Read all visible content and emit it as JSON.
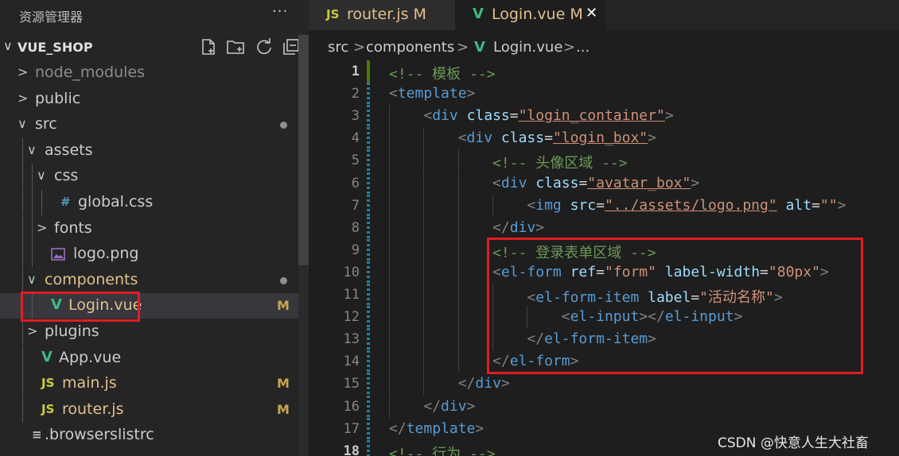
{
  "sidebar": {
    "title": "资源管理器",
    "more_label": "···",
    "project": "VUE_SHOP",
    "actions": [
      "new-file-icon",
      "new-folder-icon",
      "refresh-icon",
      "collapse-all-icon"
    ],
    "tree": [
      {
        "label": "node_modules",
        "type": "folder",
        "expanded": false,
        "depth": 0,
        "dim": true
      },
      {
        "label": "public",
        "type": "folder",
        "expanded": false,
        "depth": 0
      },
      {
        "label": "src",
        "type": "folder",
        "expanded": true,
        "depth": 0,
        "modified_dot": true
      },
      {
        "label": "assets",
        "type": "folder",
        "expanded": true,
        "depth": 1
      },
      {
        "label": "css",
        "type": "folder",
        "expanded": true,
        "depth": 2
      },
      {
        "label": "global.css",
        "type": "css",
        "icon": "#",
        "depth": 3
      },
      {
        "label": "fonts",
        "type": "folder",
        "expanded": false,
        "depth": 2
      },
      {
        "label": "logo.png",
        "type": "image",
        "depth": 2
      },
      {
        "label": "components",
        "type": "folder",
        "expanded": true,
        "depth": 1,
        "modified_dot": true,
        "modified": true
      },
      {
        "label": "Login.vue",
        "type": "vue",
        "icon": "V",
        "depth": 2,
        "badge": "M",
        "modified": true,
        "selected": true
      },
      {
        "label": "plugins",
        "type": "folder",
        "expanded": false,
        "depth": 1
      },
      {
        "label": "App.vue",
        "type": "vue",
        "icon": "V",
        "depth": 1
      },
      {
        "label": "main.js",
        "type": "js",
        "icon": "JS",
        "depth": 1,
        "badge": "M",
        "modified": true
      },
      {
        "label": "router.js",
        "type": "js",
        "icon": "JS",
        "depth": 1,
        "badge": "M",
        "modified": true
      },
      {
        "label": ".browserslistrc",
        "type": "config",
        "icon": "≡",
        "depth": 0
      }
    ]
  },
  "tabs": [
    {
      "icon": "JS",
      "label": "router.js",
      "badge": "M",
      "active": false
    },
    {
      "icon": "V",
      "label": "Login.vue",
      "badge": "M",
      "close": "✕",
      "active": true
    }
  ],
  "breadcrumb": [
    "src",
    ">",
    "components",
    ">",
    "V",
    "Login.vue",
    ">",
    "..."
  ],
  "code": {
    "lines": [
      {
        "n": "1",
        "tokens": [
          [
            "c-com",
            "<!-- 模板 -->"
          ]
        ]
      },
      {
        "n": "2",
        "tokens": [
          [
            "c-pun",
            "<"
          ],
          [
            "c-tag",
            "template"
          ],
          [
            "c-pun",
            ">"
          ]
        ]
      },
      {
        "n": "3",
        "tokens": [
          [
            "",
            "    "
          ],
          [
            "c-pun",
            "<"
          ],
          [
            "c-tag",
            "div"
          ],
          [
            "",
            " "
          ],
          [
            "c-attr",
            "class"
          ],
          [
            "c-eq",
            "="
          ],
          [
            "c-str u",
            "\"login_container\""
          ],
          [
            "c-pun",
            ">"
          ]
        ]
      },
      {
        "n": "4",
        "tokens": [
          [
            "",
            "        "
          ],
          [
            "c-pun",
            "<"
          ],
          [
            "c-tag",
            "div"
          ],
          [
            "",
            " "
          ],
          [
            "c-attr",
            "class"
          ],
          [
            "c-eq",
            "="
          ],
          [
            "c-str u",
            "\"login_box\""
          ],
          [
            "c-pun",
            ">"
          ]
        ]
      },
      {
        "n": "5",
        "tokens": [
          [
            "",
            "            "
          ],
          [
            "c-com",
            "<!-- 头像区域 -->"
          ]
        ]
      },
      {
        "n": "6",
        "tokens": [
          [
            "",
            "            "
          ],
          [
            "c-pun",
            "<"
          ],
          [
            "c-tag",
            "div"
          ],
          [
            "",
            " "
          ],
          [
            "c-attr",
            "class"
          ],
          [
            "c-eq",
            "="
          ],
          [
            "c-str u",
            "\"avatar_box\""
          ],
          [
            "c-pun",
            ">"
          ]
        ]
      },
      {
        "n": "7",
        "tokens": [
          [
            "",
            "                "
          ],
          [
            "c-pun",
            "<"
          ],
          [
            "c-tag",
            "img"
          ],
          [
            "",
            " "
          ],
          [
            "c-attr",
            "src"
          ],
          [
            "c-eq",
            "="
          ],
          [
            "c-str u",
            "\"../assets/logo.png\""
          ],
          [
            "",
            " "
          ],
          [
            "c-attr",
            "alt"
          ],
          [
            "c-eq",
            "="
          ],
          [
            "c-str",
            "\"\""
          ],
          [
            "c-pun",
            ">"
          ]
        ]
      },
      {
        "n": "8",
        "tokens": [
          [
            "",
            "            "
          ],
          [
            "c-pun",
            "</"
          ],
          [
            "c-tag",
            "div"
          ],
          [
            "c-pun",
            ">"
          ]
        ]
      },
      {
        "n": "9",
        "tokens": [
          [
            "",
            "            "
          ],
          [
            "c-com",
            "<!-- 登录表单区域 -->"
          ]
        ]
      },
      {
        "n": "10",
        "tokens": [
          [
            "",
            "            "
          ],
          [
            "c-pun",
            "<"
          ],
          [
            "c-tag",
            "el-form"
          ],
          [
            "",
            " "
          ],
          [
            "c-attr",
            "ref"
          ],
          [
            "c-eq",
            "="
          ],
          [
            "c-str",
            "\"form\""
          ],
          [
            "",
            " "
          ],
          [
            "c-attr",
            "label-width"
          ],
          [
            "c-eq",
            "="
          ],
          [
            "c-str",
            "\"80px\""
          ],
          [
            "c-pun",
            ">"
          ]
        ]
      },
      {
        "n": "11",
        "tokens": [
          [
            "",
            "                "
          ],
          [
            "c-pun",
            "<"
          ],
          [
            "c-tag",
            "el-form-item"
          ],
          [
            "",
            " "
          ],
          [
            "c-attr",
            "label"
          ],
          [
            "c-eq",
            "="
          ],
          [
            "c-str",
            "\"活动名称\""
          ],
          [
            "c-pun",
            ">"
          ]
        ]
      },
      {
        "n": "12",
        "tokens": [
          [
            "",
            "                    "
          ],
          [
            "c-pun",
            "<"
          ],
          [
            "c-tag",
            "el-input"
          ],
          [
            "c-pun",
            "></"
          ],
          [
            "c-tag",
            "el-input"
          ],
          [
            "c-pun",
            ">"
          ]
        ]
      },
      {
        "n": "13",
        "tokens": [
          [
            "",
            "                "
          ],
          [
            "c-pun",
            "</"
          ],
          [
            "c-tag",
            "el-form-item"
          ],
          [
            "c-pun",
            ">"
          ]
        ]
      },
      {
        "n": "14",
        "tokens": [
          [
            "",
            "            "
          ],
          [
            "c-pun",
            "</"
          ],
          [
            "c-tag",
            "el-form"
          ],
          [
            "c-pun",
            ">"
          ]
        ]
      },
      {
        "n": "15",
        "tokens": [
          [
            "",
            "        "
          ],
          [
            "c-pun",
            "</"
          ],
          [
            "c-tag",
            "div"
          ],
          [
            "c-pun",
            ">"
          ]
        ]
      },
      {
        "n": "16",
        "tokens": [
          [
            "",
            "    "
          ],
          [
            "c-pun",
            "</"
          ],
          [
            "c-tag",
            "div"
          ],
          [
            "c-pun",
            ">"
          ]
        ]
      },
      {
        "n": "17",
        "tokens": [
          [
            "c-pun",
            "</"
          ],
          [
            "c-tag",
            "template"
          ],
          [
            "c-pun",
            ">"
          ]
        ]
      },
      {
        "n": "18",
        "tokens": [
          [
            "c-com",
            "<!-- 行为 -->"
          ]
        ]
      }
    ]
  },
  "watermark": "CSDN @快意人生大社畜",
  "colors": {
    "highlight_box": "#e31b23",
    "modified": "#e2c08d",
    "vue_icon": "#41b883",
    "js_icon": "#cbcb41",
    "css_icon": "#519aba"
  }
}
